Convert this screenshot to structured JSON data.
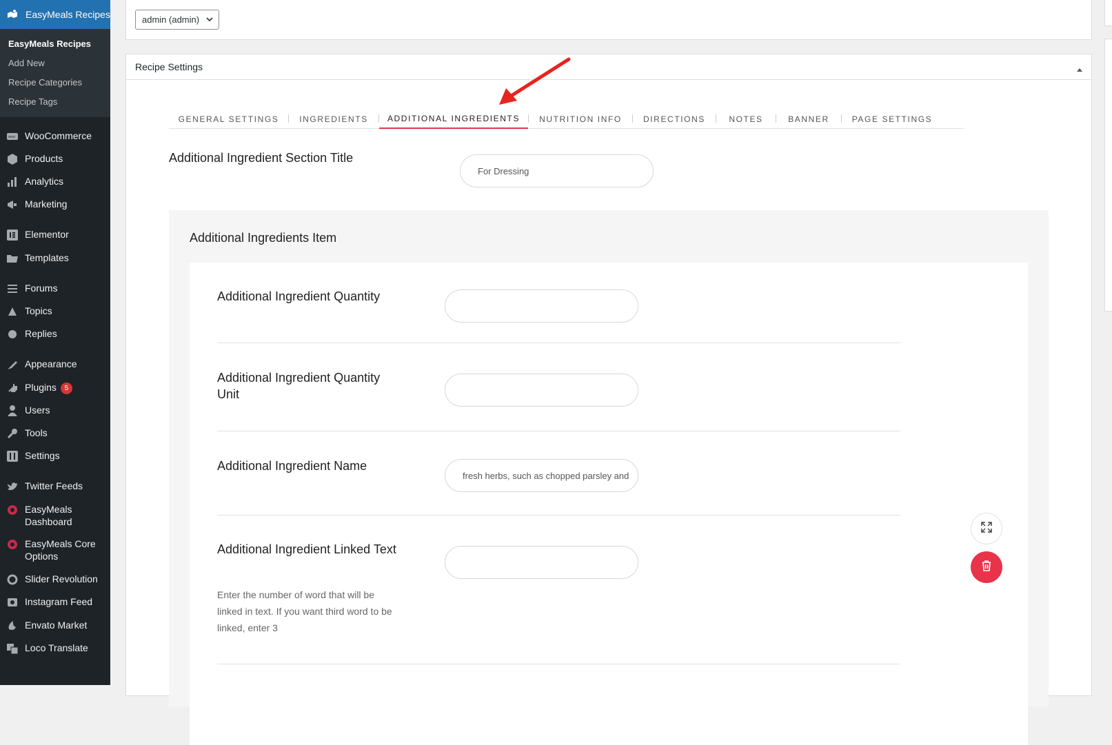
{
  "sidebar": {
    "top_item": {
      "label": "EasyMeals Recipes",
      "icon": "recipes-icon"
    },
    "submenu": [
      "EasyMeals Recipes",
      "Add New",
      "Recipe Categories",
      "Recipe Tags"
    ],
    "items": [
      {
        "label": "WooCommerce",
        "icon": "woocommerce-icon"
      },
      {
        "label": "Products",
        "icon": "products-icon"
      },
      {
        "label": "Analytics",
        "icon": "analytics-icon"
      },
      {
        "label": "Marketing",
        "icon": "marketing-icon"
      },
      {
        "label": "Elementor",
        "icon": "elementor-icon"
      },
      {
        "label": "Templates",
        "icon": "templates-icon"
      },
      {
        "label": "Forums",
        "icon": "forums-icon"
      },
      {
        "label": "Topics",
        "icon": "topics-icon"
      },
      {
        "label": "Replies",
        "icon": "replies-icon"
      },
      {
        "label": "Appearance",
        "icon": "appearance-icon"
      },
      {
        "label": "Plugins",
        "icon": "plugins-icon",
        "badge": "5"
      },
      {
        "label": "Users",
        "icon": "users-icon"
      },
      {
        "label": "Tools",
        "icon": "tools-icon"
      },
      {
        "label": "Settings",
        "icon": "settings-icon"
      },
      {
        "label": "Twitter Feeds",
        "icon": "twitter-icon"
      },
      {
        "label": "EasyMeals Dashboard",
        "icon": "easymeals-icon"
      },
      {
        "label": "EasyMeals Core Options",
        "icon": "easymeals-icon"
      },
      {
        "label": "Slider Revolution",
        "icon": "slider-icon"
      },
      {
        "label": "Instagram Feed",
        "icon": "instagram-icon"
      },
      {
        "label": "Envato Market",
        "icon": "envato-icon"
      },
      {
        "label": "Loco Translate",
        "icon": "translate-icon"
      }
    ]
  },
  "author": {
    "selected": "admin (admin)"
  },
  "panel": {
    "title": "Recipe Settings"
  },
  "tabs": [
    "GENERAL SETTINGS",
    "INGREDIENTS",
    "ADDITIONAL INGREDIENTS",
    "NUTRITION INFO",
    "DIRECTIONS",
    "NOTES",
    "BANNER",
    "PAGE SETTINGS"
  ],
  "active_tab": "ADDITIONAL INGREDIENTS",
  "section": {
    "label": "Additional Ingredient Section Title",
    "value": "For Dressing"
  },
  "group": {
    "title": "Additional Ingredients Item"
  },
  "fields": {
    "quantity": {
      "label": "Additional Ingredient Quantity",
      "value": ""
    },
    "unit": {
      "label": "Additional Ingredient Quantity Unit",
      "value": ""
    },
    "name": {
      "label": "Additional Ingredient Name",
      "value": "fresh herbs, such as chopped parsley and"
    },
    "linked": {
      "label": "Additional Ingredient Linked Text",
      "value": "",
      "help": "Enter the number of word that will be linked in text. If you want third word to be linked, enter 3"
    }
  },
  "colors": {
    "accent": "#e8334a",
    "sidebar_bg": "#1d2327",
    "sidebar_active": "#2271b1",
    "arrow": "#e8231e"
  }
}
